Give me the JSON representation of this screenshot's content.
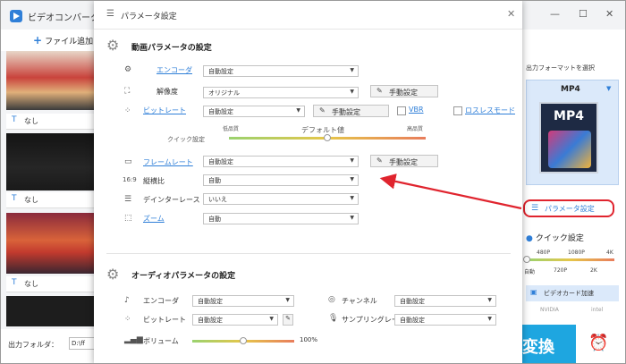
{
  "app": {
    "title": "ビデオコンバータ",
    "add_files": "ファイル追加",
    "item_subtitle": "なし",
    "output_folder_label": "出力フォルダ：",
    "output_folder_value": "D:\\ff",
    "output_format_label": "出力フォーマットを選択",
    "format_name": "MP4",
    "format_icon_text": "MP4",
    "param_button": "パラメータ設定",
    "quick_settings": "クイック設定",
    "quick_levels_top": [
      "480P",
      "1080P",
      "4K"
    ],
    "quick_levels_bottom": [
      "自動",
      "720P",
      "2K"
    ],
    "gpu_accel": "ビデオカード加速",
    "vendors": [
      "NVIDIA",
      "intel"
    ],
    "convert_label": "変換"
  },
  "dialog": {
    "title": "パラメータ設定",
    "video": {
      "heading": "動画パラメータの設定",
      "encoder_label": "エンコーダ",
      "encoder_value": "自動設定",
      "resolution_label": "解像度",
      "resolution_value": "オリジナル",
      "bitrate_label": "ビットレート",
      "bitrate_value": "自動設定",
      "manual_label": "手動設定",
      "vbr_label": "VBR",
      "lossless_label": "ロスレスモード",
      "quick_label": "クイック設定",
      "quality_low": "低品質",
      "quality_default": "デフォルト値",
      "quality_high": "高品質",
      "quality_level": 0.5,
      "framerate_label": "フレームレート",
      "framerate_value": "自動設定",
      "aspect_label": "縦横比",
      "aspect_value": "自動",
      "deinterlace_label": "デインターレース",
      "deinterlace_value": "いいえ",
      "zoom_label": "ズーム",
      "zoom_value": "自動"
    },
    "audio": {
      "heading": "オーディオパラメータの設定",
      "encoder_label": "エンコーダ",
      "encoder_value": "自動設定",
      "channel_label": "チャンネル",
      "channel_value": "自動設定",
      "bitrate_label": "ビットレート",
      "bitrate_value": "自動設定",
      "samplerate_label": "サンプリングレート",
      "samplerate_value": "自動設定",
      "volume_label": "ボリューム",
      "volume_value": "100%",
      "volume_level": 0.5
    }
  },
  "colors": {
    "accent": "#2f7fd8",
    "highlight": "#e0242e",
    "convert": "#1ea6e0"
  }
}
